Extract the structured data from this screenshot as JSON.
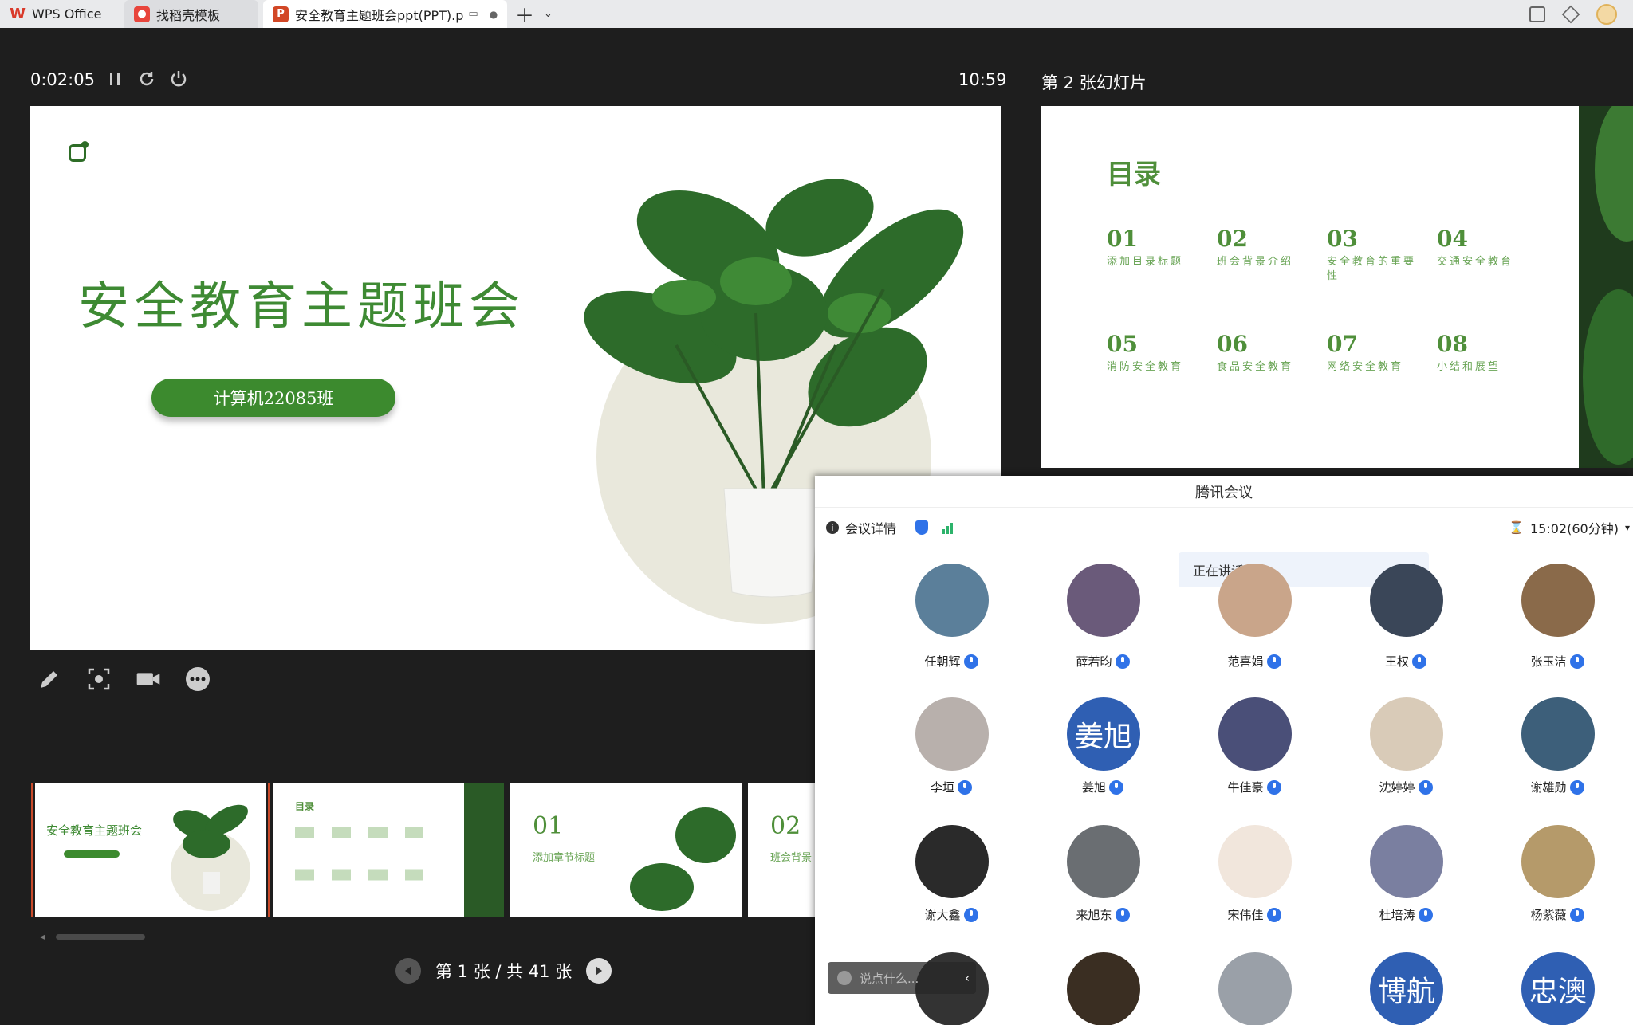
{
  "tabs": [
    {
      "label": "WPS Office",
      "icon": "wps-logo-icon"
    },
    {
      "label": "找稻壳模板",
      "icon": "docer-logo-icon"
    },
    {
      "label": "安全教育主题班会ppt(PPT).p",
      "icon": "ppt-file-icon"
    }
  ],
  "presenter": {
    "elapsed": "0:02:05",
    "clock": "10:59",
    "next_slide_label": "第 2 张幻灯片",
    "page_indicator": "第 1 张 / 共 41 张"
  },
  "slide1": {
    "title": "安全教育主题班会",
    "class_pill": "计算机22085班"
  },
  "slide2": {
    "toc_title": "目录",
    "items": [
      {
        "num": "01",
        "text": "添加目录标题"
      },
      {
        "num": "02",
        "text": "班会背景介绍"
      },
      {
        "num": "03",
        "text": "安全教育的重要性"
      },
      {
        "num": "04",
        "text": "交通安全教育"
      },
      {
        "num": "05",
        "text": "消防安全教育"
      },
      {
        "num": "06",
        "text": "食品安全教育"
      },
      {
        "num": "07",
        "text": "网络安全教育"
      },
      {
        "num": "08",
        "text": "小结和展望"
      }
    ]
  },
  "thumbnails": {
    "t1_title": "安全教育主题班会",
    "t2_title": "目录",
    "t3_num": "01",
    "t3_text": "添加章节标题",
    "t4_num": "02",
    "t4_text": "班会背景"
  },
  "meeting": {
    "window_title": "腾讯会议",
    "details_label": "会议详情",
    "duration": "15:02(60分钟)",
    "speaking_label": "正在讲话:",
    "chat_placeholder": "说点什么...",
    "participants_row1": [
      "任朝辉",
      "薛若昀",
      "范喜娟",
      "王权",
      "张玉洁"
    ],
    "participants_row2": [
      "李垣",
      "姜旭",
      "牛佳豪",
      "沈婷婷",
      "谢雄勋"
    ],
    "participants_row3": [
      "谢大鑫",
      "来旭东",
      "宋伟佳",
      "杜培涛",
      "杨紫薇"
    ],
    "avatar_text": {
      "jiangxu": "姜旭",
      "bohang": "博航",
      "zhongao": "忠澳"
    }
  },
  "colors": {
    "accent_green": "#3c8a2e",
    "mic_blue": "#2f72e8",
    "avatar_blue": "#2f5fb3",
    "selected_thumb": "#c94a2a"
  }
}
